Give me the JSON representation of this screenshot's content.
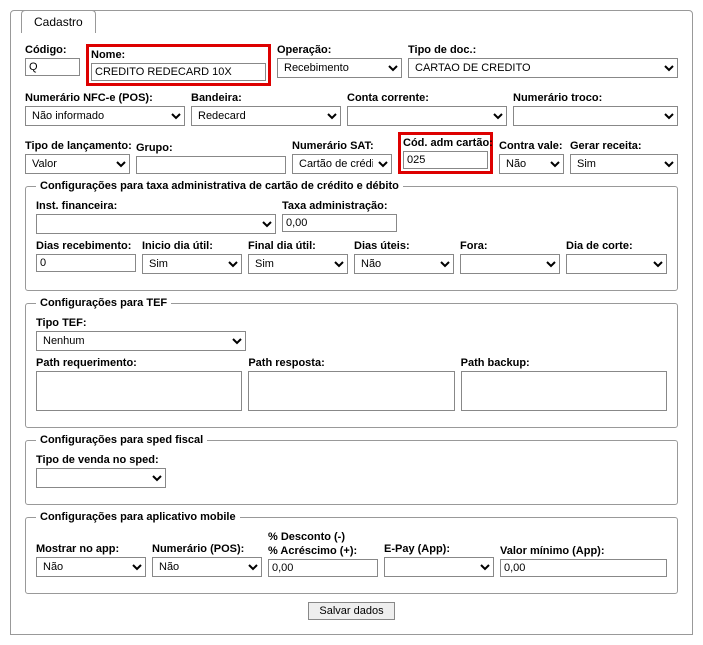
{
  "tab_title": "Cadastro",
  "row1": {
    "codigo_label": "Código:",
    "codigo_value": "Q",
    "nome_label": "Nome:",
    "nome_value": "CREDITO REDECARD 10X",
    "operacao_label": "Operação:",
    "operacao_value": "Recebimento",
    "tipodoc_label": "Tipo de doc.:",
    "tipodoc_value": "CARTAO DE CREDITO"
  },
  "row2": {
    "numnfce_label": "Numerário NFC-e (POS):",
    "numnfce_value": "Não informado",
    "bandeira_label": "Bandeira:",
    "bandeira_value": "Redecard",
    "contacorrente_label": "Conta corrente:",
    "contacorrente_value": "",
    "numtroco_label": "Numerário troco:",
    "numtroco_value": ""
  },
  "row3": {
    "tipolanc_label": "Tipo de lançamento:",
    "tipolanc_value": "Valor",
    "grupo_label": "Grupo:",
    "grupo_value": "",
    "numsat_label": "Numerário SAT:",
    "numsat_value": "Cartão de crédito",
    "codadm_label": "Cód. adm cartão:",
    "codadm_value": "025",
    "contravale_label": "Contra vale:",
    "contravale_value": "Não",
    "gerarreceita_label": "Gerar receita:",
    "gerarreceita_value": "Sim"
  },
  "fieldset1": {
    "legend": "Configurações para taxa administrativa de cartão de crédito e débito",
    "instfin_label": "Inst. financeira:",
    "instfin_value": "",
    "taxaadm_label": "Taxa administração:",
    "taxaadm_value": "0,00",
    "diasreceb_label": "Dias recebimento:",
    "diasreceb_value": "0",
    "iniciodia_label": "Inicio dia útil:",
    "iniciodia_value": "Sim",
    "finaldia_label": "Final dia útil:",
    "finaldia_value": "Sim",
    "diasuteis_label": "Dias úteis:",
    "diasuteis_value": "Não",
    "fora_label": "Fora:",
    "fora_value": "",
    "diacorte_label": "Dia de corte:",
    "diacorte_value": ""
  },
  "fieldset2": {
    "legend": "Configurações para TEF",
    "tipotef_label": "Tipo TEF:",
    "tipotef_value": "Nenhum",
    "pathreq_label": "Path requerimento:",
    "pathreq_value": "",
    "pathresp_label": "Path resposta:",
    "pathresp_value": "",
    "pathbackup_label": "Path backup:",
    "pathbackup_value": ""
  },
  "fieldset3": {
    "legend": "Configurações para sped fiscal",
    "tipovenda_label": "Tipo de venda no sped:",
    "tipovenda_value": ""
  },
  "fieldset4": {
    "legend": "Configurações para aplicativo mobile",
    "mostrar_label": "Mostrar no app:",
    "mostrar_value": "Não",
    "numerario_label": "Numerário (POS):",
    "numerario_value": "Não",
    "desconto_label1": "% Desconto (-)",
    "desconto_label2": "% Acréscimo (+):",
    "desconto_value": "0,00",
    "epay_label": "E-Pay (App):",
    "epay_value": "",
    "valormin_label": "Valor mínimo (App):",
    "valormin_value": "0,00"
  },
  "save_button": "Salvar dados"
}
